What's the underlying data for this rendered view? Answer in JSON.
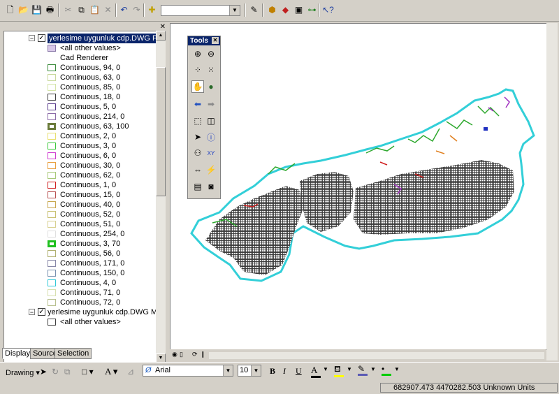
{
  "toolbar": {
    "icons": [
      "new-icon",
      "open-icon",
      "save-icon",
      "print-icon",
      "cut-icon",
      "copy-icon",
      "paste-icon",
      "delete-icon",
      "undo-icon",
      "redo-icon",
      "add-data-icon",
      "editor-icon",
      "arctoolbox-icon",
      "arccatalog-icon",
      "model-icon",
      "whats-this-icon"
    ]
  },
  "toc": {
    "layers": [
      {
        "name": "yerlesime uygunluk cdp.DWG Polygon",
        "checked": true,
        "expanded": true
      },
      {
        "name": "yerlesime uygunluk cdp.DWG MultiPatch",
        "checked": true,
        "expanded": true
      }
    ],
    "other_values_label": "<all other values>",
    "renderer_label": "Cad Renderer",
    "classes": [
      {
        "label": "Continuous, 94, 0",
        "color": "#3c8c3c"
      },
      {
        "label": "Continuous, 63, 0",
        "color": "#c8d89c"
      },
      {
        "label": "Continuous, 85, 0",
        "color": "#d4e4a8"
      },
      {
        "label": "Continuous, 18, 0",
        "color": "#404040"
      },
      {
        "label": "Continuous, 5, 0",
        "color": "#5a3c8c"
      },
      {
        "label": "Continuous, 214, 0",
        "color": "#8c6ca8"
      },
      {
        "label": "Continuous, 63, 100",
        "color": "#6c7c3c",
        "thick": true
      },
      {
        "label": "Continuous, 2, 0",
        "color": "#e8e070"
      },
      {
        "label": "Continuous, 3, 0",
        "color": "#3cc83c"
      },
      {
        "label": "Continuous, 6, 0",
        "color": "#d03cd0"
      },
      {
        "label": "Continuous, 30, 0",
        "color": "#e8a040"
      },
      {
        "label": "Continuous, 62, 0",
        "color": "#a8c878"
      },
      {
        "label": "Continuous, 1, 0",
        "color": "#d02020"
      },
      {
        "label": "Continuous, 15, 0",
        "color": "#b85050"
      },
      {
        "label": "Continuous, 40, 0",
        "color": "#c8a850"
      },
      {
        "label": "Continuous, 52, 0",
        "color": "#c8c070"
      },
      {
        "label": "Continuous, 51, 0",
        "color": "#d8d090"
      },
      {
        "label": "Continuous, 254, 0",
        "color": "#e0e0e0"
      },
      {
        "label": "Continuous, 3, 70",
        "color": "#20c020",
        "thick": true
      },
      {
        "label": "Continuous, 56, 0",
        "color": "#b0b070"
      },
      {
        "label": "Continuous, 171, 0",
        "color": "#8888a8"
      },
      {
        "label": "Continuous, 150, 0",
        "color": "#7890b0"
      },
      {
        "label": "Continuous, 4, 0",
        "color": "#30c8d8"
      },
      {
        "label": "Continuous, 71, 0",
        "color": "#d8e0b0"
      },
      {
        "label": "Continuous, 72, 0",
        "color": "#b8c090"
      }
    ],
    "tabs": [
      "Display",
      "Source",
      "Selection"
    ]
  },
  "tools": {
    "title": "Tools",
    "icons": [
      "zoom-in-icon",
      "zoom-out-icon",
      "fixed-zoom-in-icon",
      "fixed-zoom-out-icon",
      "pan-icon",
      "full-extent-icon",
      "back-icon",
      "forward-icon",
      "select-features-icon",
      "clear-selection-icon",
      "select-elements-icon",
      "identify-icon",
      "find-icon",
      "go-to-xy-icon",
      "measure-icon",
      "hyperlink-icon",
      "html-popup-icon",
      "time-slider-icon"
    ]
  },
  "drawing": {
    "label": "Drawing",
    "font_name": "Arial",
    "font_size": "10",
    "bold": "B",
    "italic": "I",
    "underline": "U",
    "text_tool": "A",
    "font_color_letter": "A",
    "colors": {
      "font": "#000000",
      "fill": "#ffff00",
      "line": "#5a5ab4",
      "marker": "#00cc00"
    }
  },
  "status": {
    "coords": "682907.473  4470282.503 Unknown Units"
  },
  "map": {
    "region_colors": {
      "outline": "#33cfd8",
      "hatch": "#3a3a3a",
      "green": "#2ea82e",
      "red": "#d02020",
      "purple": "#a030c0",
      "blue": "#2030c0",
      "orange": "#e08020"
    }
  }
}
